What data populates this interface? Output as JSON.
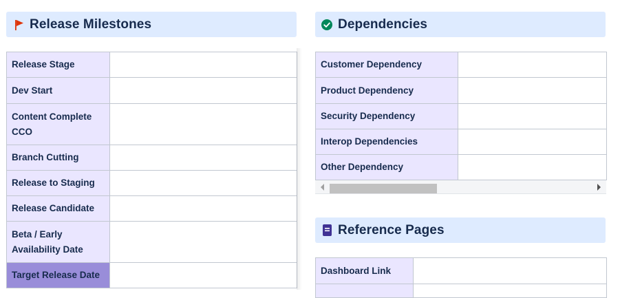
{
  "milestones": {
    "title": "Release Milestones",
    "icon": "red-flag-icon",
    "rows": [
      {
        "label": "Release Stage",
        "value": ""
      },
      {
        "label": "Dev Start",
        "value": ""
      },
      {
        "label": "Content Complete CCO",
        "value": ""
      },
      {
        "label": "Branch Cutting",
        "value": ""
      },
      {
        "label": "Release to Staging",
        "value": ""
      },
      {
        "label": "Release Candidate",
        "value": ""
      },
      {
        "label": "Beta / Early Availability Date",
        "value": ""
      },
      {
        "label": "Target Release Date",
        "value": ""
      }
    ]
  },
  "dependencies": {
    "title": "Dependencies",
    "icon": "green-check-circle-icon",
    "rows": [
      {
        "label": "Customer Dependency",
        "value": ""
      },
      {
        "label": "Product Dependency",
        "value": ""
      },
      {
        "label": "Security Dependency",
        "value": ""
      },
      {
        "label": "Interop Dependencies",
        "value": ""
      },
      {
        "label": "Other Dependency",
        "value": ""
      }
    ]
  },
  "reference": {
    "title": "Reference Pages",
    "icon": "page-icon",
    "rows": [
      {
        "label": "Dashboard Link",
        "value": ""
      }
    ]
  },
  "colors": {
    "header_bg": "#deebff",
    "key_cell_bg": "#eae6ff",
    "highlight_key_bg": "#998dd9",
    "text": "#172b4d",
    "flag": "#de350b",
    "check": "#00875a",
    "page_icon": "#403294"
  }
}
